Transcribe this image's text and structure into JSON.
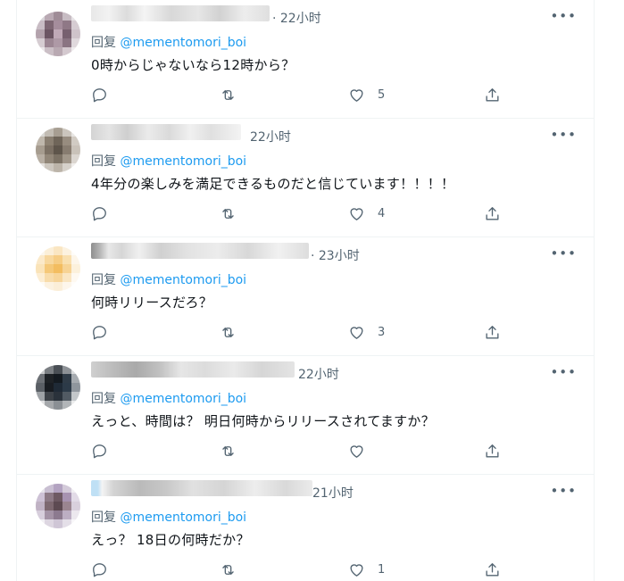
{
  "reply_prefix": "回复",
  "tweets": [
    {
      "time": "· 22小时",
      "handle": "@mementomori_boi",
      "text": "0時からじゃないなら12時から？",
      "likes": "5"
    },
    {
      "time": "22小时",
      "handle": "@mementomori_boi",
      "text": "4年分の楽しみを満足できるものだと信じています！！！！",
      "likes": "4"
    },
    {
      "time": "· 23小时",
      "handle": "@mementomori_boi",
      "text": "何時リリースだろ？",
      "likes": "3"
    },
    {
      "time": "22小时",
      "handle": "@mementomori_boi",
      "text": "えっと、時間は？ 明日何時からリリースされてますか？",
      "likes": ""
    },
    {
      "time": "21小时",
      "handle": "@mementomori_boi",
      "text": "えっ？ 18日の何時だか？",
      "likes": "1"
    }
  ],
  "icons": {
    "more": "more-icon",
    "reply": "reply-icon",
    "retweet": "retweet-icon",
    "like": "like-icon",
    "share": "share-icon"
  },
  "colors": {
    "link": "#1d9bf0",
    "muted": "#536471",
    "text": "#0f1419",
    "border": "#eff3f4"
  }
}
